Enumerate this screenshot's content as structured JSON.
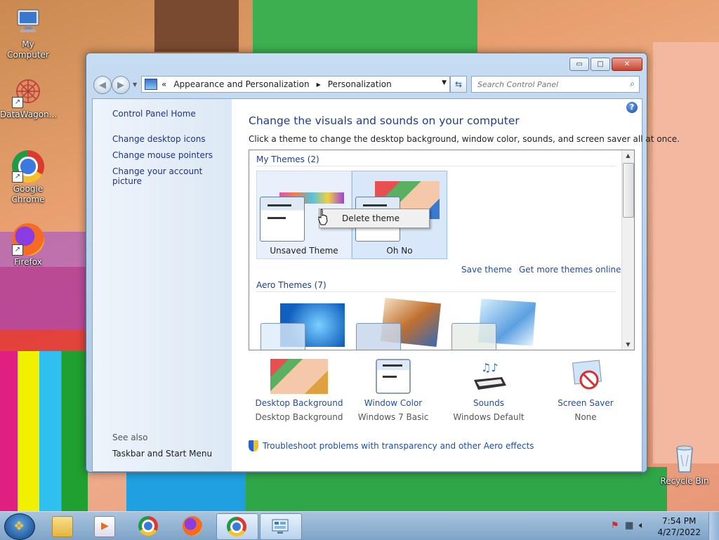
{
  "desktop": {
    "icons": [
      {
        "label": "My Computer",
        "icon": "computer-icon"
      },
      {
        "label": "DataWagon...",
        "icon": "datawagon-icon"
      },
      {
        "label": "Google Chrome",
        "icon": "chrome-icon"
      },
      {
        "label": "Firefox",
        "icon": "firefox-icon"
      },
      {
        "label": "Recycle Bin",
        "icon": "recycle-bin-icon"
      }
    ]
  },
  "window": {
    "caption": {
      "minimize": "▭",
      "maximize": "□",
      "close": "✕"
    },
    "nav": {
      "back": "◀",
      "forward": "▶",
      "breadcrumb_prefix": "«",
      "breadcrumb": [
        "Appearance and Personalization",
        "Personalization"
      ],
      "separator": "▶",
      "search_placeholder": "Search Control Panel"
    },
    "sidebar": {
      "home": "Control Panel Home",
      "links": [
        "Change desktop icons",
        "Change mouse pointers",
        "Change your account picture"
      ],
      "see_also_heading": "See also",
      "see_also": [
        "Taskbar and Start Menu"
      ]
    },
    "main": {
      "help": "?",
      "title": "Change the visuals and sounds on your computer",
      "subtitle": "Click a theme to change the desktop background, window color, sounds, and screen saver all at once.",
      "my_themes_heading": "My Themes (2)",
      "my_themes": [
        {
          "name": "Unsaved Theme"
        },
        {
          "name": "Oh No"
        }
      ],
      "context_menu": {
        "item": "Delete theme"
      },
      "save_theme": "Save theme",
      "get_more": "Get more themes online",
      "aero_heading": "Aero Themes (7)",
      "settings": [
        {
          "title": "Desktop Background",
          "value": "Desktop Background",
          "icon": "desktop-background-icon"
        },
        {
          "title": "Window Color",
          "value": "Windows 7 Basic",
          "icon": "window-color-icon"
        },
        {
          "title": "Sounds",
          "value": "Windows Default",
          "icon": "sounds-icon"
        },
        {
          "title": "Screen Saver",
          "value": "None",
          "icon": "screen-saver-icon"
        }
      ],
      "troubleshoot": "Troubleshoot problems with transparency and other Aero effects"
    }
  },
  "taskbar": {
    "time": "7:54 PM",
    "date": "4/27/2022"
  },
  "colors": {
    "link": "#1e4ea8",
    "heading": "#1e3d8c",
    "selection": "#d8e8fa"
  }
}
